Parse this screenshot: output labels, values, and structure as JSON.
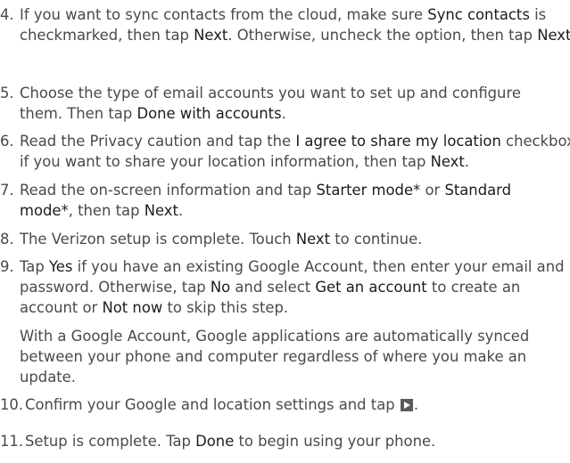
{
  "steps": [
    {
      "num": "4.",
      "parts": [
        "If you want to sync contacts from the cloud, make sure ",
        "Sync contacts",
        " is checkmarked, then tap ",
        "Next",
        ". Otherwise, uncheck the option, then tap ",
        "Next",
        "."
      ]
    },
    {
      "num": "5.",
      "parts": [
        "Choose the type of email accounts you want to set up and configure them. Then tap ",
        "Done with accounts",
        "."
      ]
    },
    {
      "num": "6.",
      "parts": [
        "Read the Privacy caution and tap the ",
        "I agree to share my location",
        " checkbox if you want to share your location information, then tap ",
        "Next",
        "."
      ]
    },
    {
      "num": "7.",
      "parts": [
        "Read the on-screen information and tap ",
        "Starter mode*",
        " or ",
        "Standard mode*",
        ", then tap ",
        "Next",
        "."
      ]
    },
    {
      "num": "8.",
      "parts": [
        "The Verizon setup is complete. Touch ",
        "Next",
        " to continue."
      ]
    },
    {
      "num": "9.",
      "parts": [
        "Tap ",
        "Yes",
        " if you have an existing Google Account, then enter your email and password. Otherwise, tap ",
        "No",
        " and select ",
        "Get an account",
        " to create an account or ",
        "Not now",
        " to skip this step."
      ],
      "note": "With a Google Account, Google applications are automatically synced between your phone and computer regardless of where you make an update."
    },
    {
      "num": "10.",
      "parts": [
        "Confirm your Google and location settings and tap ",
        "."
      ],
      "icon": "play-arrow-icon"
    },
    {
      "num": "11.",
      "parts": [
        "Setup is complete. Tap ",
        "Done",
        " to begin using your phone."
      ]
    }
  ]
}
